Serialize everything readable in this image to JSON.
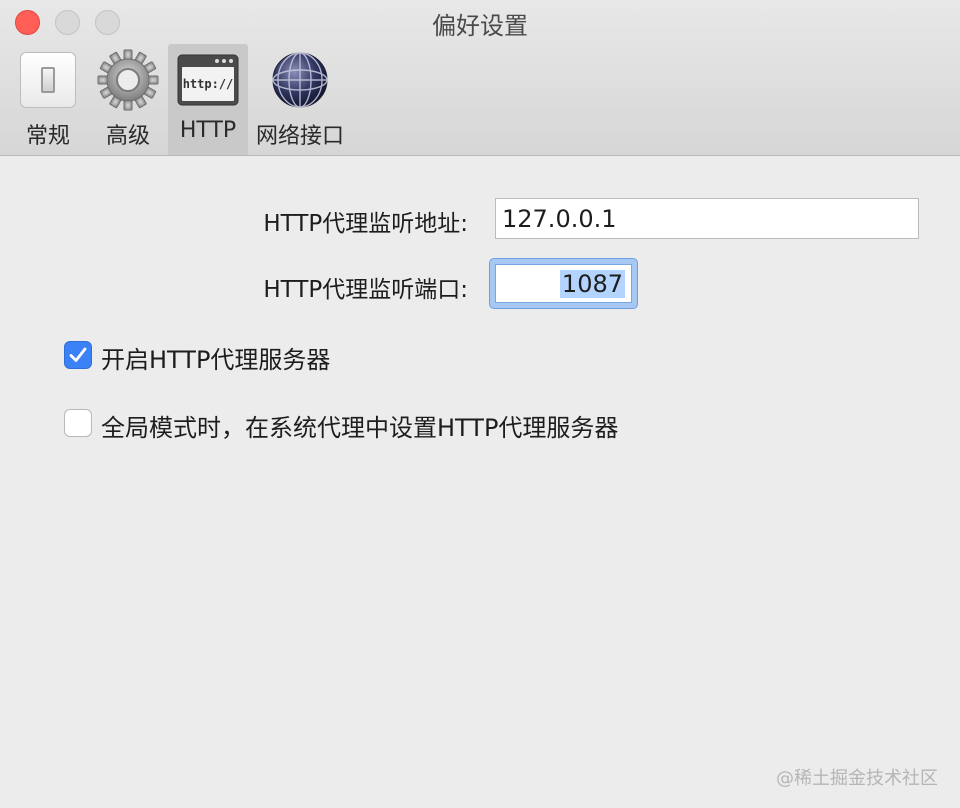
{
  "window": {
    "title": "偏好设置"
  },
  "toolbar": {
    "items": [
      {
        "label": "常规",
        "icon": "toggle-switch-icon"
      },
      {
        "label": "高级",
        "icon": "gear-icon"
      },
      {
        "label": "HTTP",
        "icon": "http-window-icon",
        "icon_text": "http://"
      },
      {
        "label": "网络接口",
        "icon": "network-globe-icon"
      }
    ],
    "selected": "HTTP"
  },
  "form": {
    "address_label": "HTTP代理监听地址:",
    "address_value": "127.0.0.1",
    "port_label": "HTTP代理监听端口:",
    "port_value": "1087"
  },
  "options": {
    "enable_label": "开启HTTP代理服务器",
    "enable_checked": true,
    "global_label": "全局模式时，在系统代理中设置HTTP代理服务器",
    "global_checked": false
  },
  "watermark": "@稀土掘金技术社区",
  "colors": {
    "accent": "#3b82f6",
    "close": "#ff5f57",
    "focus_ring": "#a6c8f2"
  }
}
